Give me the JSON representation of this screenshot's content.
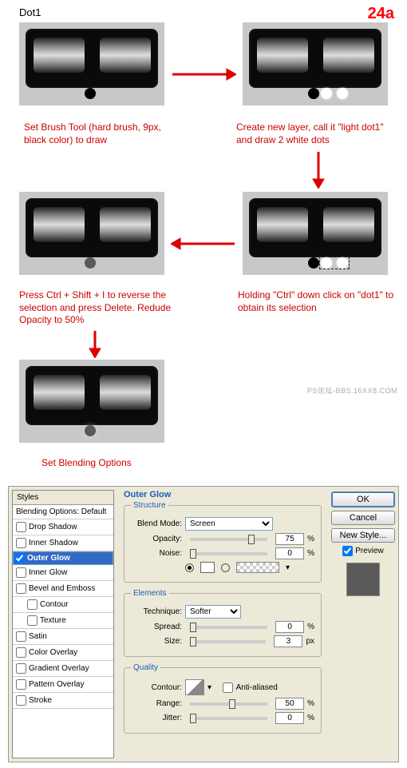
{
  "header": "Dot1",
  "step": "24a",
  "watermark": "PS论坛-BBS.16XX8.COM",
  "captions": {
    "c1": "Set Brush Tool (hard brush, 9px, black color) to draw",
    "c2": "Create new layer, call it \"light dot1\" and draw 2 white dots",
    "c3": "Holding \"Ctrl\" down click on \"dot1\" to obtain its selection",
    "c4": "Press Ctrl + Shift + I to reverse the selection and press Delete. Redude Opacity to 50%",
    "c5": "Set Blending Options"
  },
  "dialog": {
    "title": "Outer Glow",
    "styles_header": "Styles",
    "blending_default": "Blending Options: Default",
    "rows": [
      "Drop Shadow",
      "Inner Shadow",
      "Outer Glow",
      "Inner Glow",
      "Bevel and Emboss",
      "Contour",
      "Texture",
      "Satin",
      "Color Overlay",
      "Gradient Overlay",
      "Pattern Overlay",
      "Stroke"
    ],
    "structure": {
      "legend": "Structure",
      "blendmode_lbl": "Blend Mode:",
      "blendmode": "Screen",
      "opacity_lbl": "Opacity:",
      "opacity": "75",
      "noise_lbl": "Noise:",
      "noise": "0",
      "pct": "%"
    },
    "elements": {
      "legend": "Elements",
      "technique_lbl": "Technique:",
      "technique": "Softer",
      "spread_lbl": "Spread:",
      "spread": "0",
      "size_lbl": "Size:",
      "size": "3",
      "px": "px",
      "pct": "%"
    },
    "quality": {
      "legend": "Quality",
      "contour_lbl": "Contour:",
      "aa": "Anti-aliased",
      "range_lbl": "Range:",
      "range": "50",
      "jitter_lbl": "Jitter:",
      "jitter": "0",
      "pct": "%"
    },
    "buttons": {
      "ok": "OK",
      "cancel": "Cancel",
      "newstyle": "New Style...",
      "preview": "Preview"
    }
  }
}
